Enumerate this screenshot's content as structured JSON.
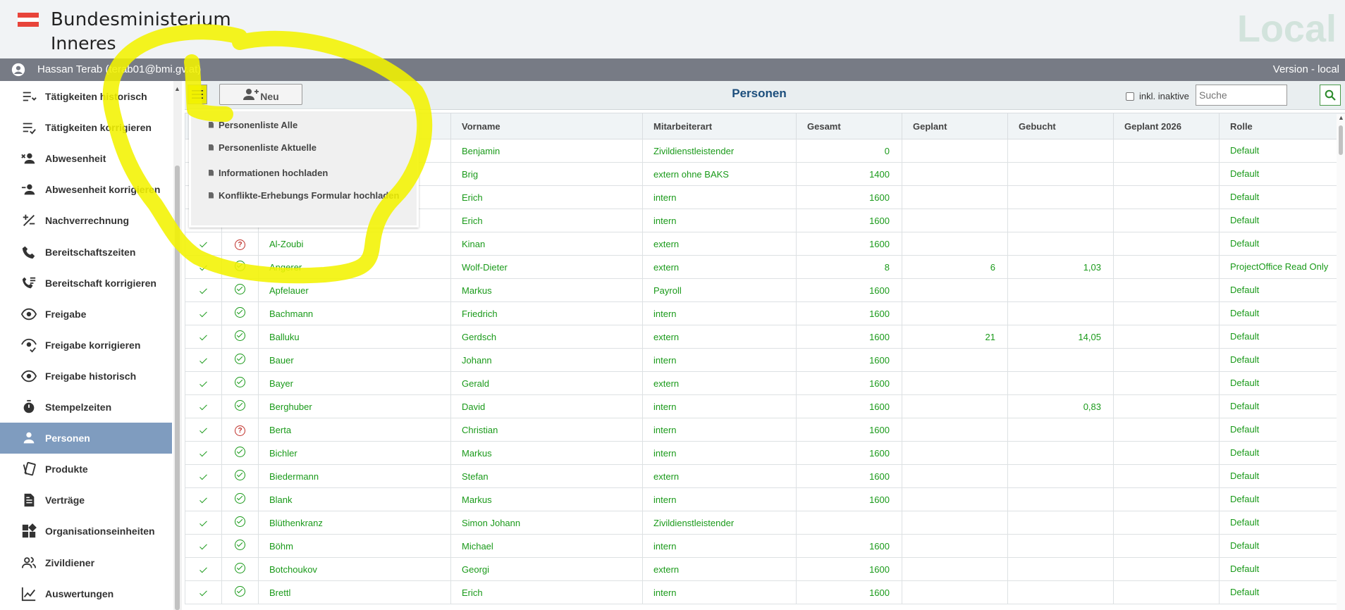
{
  "header": {
    "brand_line1": "Bundesministerium",
    "brand_line2": "Inneres",
    "environment": "Local",
    "flag_colors": [
      "#e8443a",
      "#ffffff",
      "#e8443a"
    ]
  },
  "userbar": {
    "user": "Hassan Terab (terab01@bmi.gv.at)",
    "version": "Version - local"
  },
  "sidebar": {
    "items": [
      {
        "label": "Tätigkeiten historisch",
        "icon": "list-history-icon"
      },
      {
        "label": "Tätigkeiten korrigieren",
        "icon": "list-check-icon"
      },
      {
        "label": "Abwesenheit",
        "icon": "person-remove-icon"
      },
      {
        "label": "Abwesenheit korrigieren",
        "icon": "person-edit-icon"
      },
      {
        "label": "Nachverrechnung",
        "icon": "plus-minus-icon"
      },
      {
        "label": "Bereitschaftszeiten",
        "icon": "phone-icon"
      },
      {
        "label": "Bereitschaft korrigieren",
        "icon": "phone-list-icon"
      },
      {
        "label": "Freigabe",
        "icon": "eye-icon"
      },
      {
        "label": "Freigabe korrigieren",
        "icon": "eye-check-icon"
      },
      {
        "label": "Freigabe historisch",
        "icon": "eye-history-icon"
      },
      {
        "label": "Stempelzeiten",
        "icon": "stopwatch-icon"
      },
      {
        "label": "Personen",
        "icon": "person-icon",
        "active": true
      },
      {
        "label": "Produkte",
        "icon": "cards-icon"
      },
      {
        "label": "Verträge",
        "icon": "document-icon"
      },
      {
        "label": "Organisationseinheiten",
        "icon": "org-units-icon"
      },
      {
        "label": "Zivildiener",
        "icon": "people-icon"
      },
      {
        "label": "Auswertungen",
        "icon": "chart-icon"
      }
    ]
  },
  "toolbar": {
    "new_label": "Neu",
    "title": "Personen",
    "inactive_label": "inkl. inaktive",
    "search_placeholder": "Suche"
  },
  "menu": {
    "items": [
      "Personenliste Alle",
      "Personenliste Aktuelle",
      "Informationen hochladen",
      "Konflikte-Erhebungs Formular hochladen"
    ]
  },
  "table": {
    "columns": [
      "",
      "",
      "",
      "Vorname",
      "Mitarbeiterart",
      "Gesamt",
      "Geplant",
      "Gebucht",
      "Geplant 2026",
      "Rolle"
    ],
    "rows": [
      {
        "status": "",
        "name": "",
        "vorname": "Benjamin",
        "art": "Zivildienstleistender",
        "gesamt": "0",
        "geplant": "",
        "gebucht": "",
        "geplant2026": "",
        "rolle": "Default"
      },
      {
        "status": "",
        "name": "",
        "vorname": "Brig",
        "art": "extern ohne BAKS",
        "gesamt": "1400",
        "geplant": "",
        "gebucht": "",
        "geplant2026": "",
        "rolle": "Default"
      },
      {
        "status": "",
        "name": "",
        "vorname": "Erich",
        "art": "intern",
        "gesamt": "1600",
        "geplant": "",
        "gebucht": "",
        "geplant2026": "",
        "rolle": "Default"
      },
      {
        "status": "",
        "name": "",
        "vorname": "Erich",
        "art": "intern",
        "gesamt": "1600",
        "geplant": "",
        "gebucht": "",
        "geplant2026": "",
        "rolle": "Default"
      },
      {
        "status": "q",
        "name": "Al-Zoubi",
        "vorname": "Kinan",
        "art": "extern",
        "gesamt": "1600",
        "geplant": "",
        "gebucht": "",
        "geplant2026": "",
        "rolle": "Default"
      },
      {
        "status": "ok",
        "name": "Angerer",
        "vorname": "Wolf-Dieter",
        "art": "extern",
        "gesamt": "8",
        "geplant": "6",
        "gebucht": "1,03",
        "geplant2026": "",
        "rolle": "ProjectOffice Read Only"
      },
      {
        "status": "ok",
        "name": "Apfelauer",
        "vorname": "Markus",
        "art": "Payroll",
        "gesamt": "1600",
        "geplant": "",
        "gebucht": "",
        "geplant2026": "",
        "rolle": "Default"
      },
      {
        "status": "ok",
        "name": "Bachmann",
        "vorname": "Friedrich",
        "art": "intern",
        "gesamt": "1600",
        "geplant": "",
        "gebucht": "",
        "geplant2026": "",
        "rolle": "Default"
      },
      {
        "status": "ok",
        "name": "Balluku",
        "vorname": "Gerdsch",
        "art": "extern",
        "gesamt": "1600",
        "geplant": "21",
        "gebucht": "14,05",
        "geplant2026": "",
        "rolle": "Default"
      },
      {
        "status": "ok",
        "name": "Bauer",
        "vorname": "Johann",
        "art": "intern",
        "gesamt": "1600",
        "geplant": "",
        "gebucht": "",
        "geplant2026": "",
        "rolle": "Default"
      },
      {
        "status": "ok",
        "name": "Bayer",
        "vorname": "Gerald",
        "art": "extern",
        "gesamt": "1600",
        "geplant": "",
        "gebucht": "",
        "geplant2026": "",
        "rolle": "Default"
      },
      {
        "status": "ok",
        "name": "Berghuber",
        "vorname": "David",
        "art": "intern",
        "gesamt": "1600",
        "geplant": "",
        "gebucht": "0,83",
        "geplant2026": "",
        "rolle": "Default"
      },
      {
        "status": "q",
        "name": "Berta",
        "vorname": "Christian",
        "art": "intern",
        "gesamt": "1600",
        "geplant": "",
        "gebucht": "",
        "geplant2026": "",
        "rolle": "Default"
      },
      {
        "status": "ok",
        "name": "Bichler",
        "vorname": "Markus",
        "art": "intern",
        "gesamt": "1600",
        "geplant": "",
        "gebucht": "",
        "geplant2026": "",
        "rolle": "Default"
      },
      {
        "status": "ok",
        "name": "Biedermann",
        "vorname": "Stefan",
        "art": "extern",
        "gesamt": "1600",
        "geplant": "",
        "gebucht": "",
        "geplant2026": "",
        "rolle": "Default"
      },
      {
        "status": "ok",
        "name": "Blank",
        "vorname": "Markus",
        "art": "intern",
        "gesamt": "1600",
        "geplant": "",
        "gebucht": "",
        "geplant2026": "",
        "rolle": "Default"
      },
      {
        "status": "ok",
        "name": "Blüthenkranz",
        "vorname": "Simon Johann",
        "art": "Zivildienstleistender",
        "gesamt": "",
        "geplant": "",
        "gebucht": "",
        "geplant2026": "",
        "rolle": "Default"
      },
      {
        "status": "ok",
        "name": "Böhm",
        "vorname": "Michael",
        "art": "intern",
        "gesamt": "1600",
        "geplant": "",
        "gebucht": "",
        "geplant2026": "",
        "rolle": "Default"
      },
      {
        "status": "ok",
        "name": "Botchoukov",
        "vorname": "Georgi",
        "art": "extern",
        "gesamt": "1600",
        "geplant": "",
        "gebucht": "",
        "geplant2026": "",
        "rolle": "Default"
      },
      {
        "status": "ok",
        "name": "Brettl",
        "vorname": "Erich",
        "art": "intern",
        "gesamt": "1600",
        "geplant": "",
        "gebucht": "",
        "geplant2026": "",
        "rolle": "Default"
      }
    ]
  },
  "colors": {
    "accent_green": "#1a9a1a",
    "title_blue": "#1c4e7c",
    "active_nav": "#7f9cbf",
    "annotation_yellow": "#f2f200"
  }
}
